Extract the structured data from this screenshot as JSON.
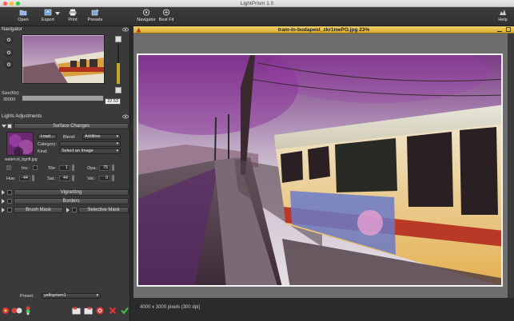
{
  "window": {
    "title": "LightPrism 1.0"
  },
  "toolbar": {
    "open": "Open",
    "export": "Export",
    "print": "Print",
    "presets": "Presets",
    "navigator": "Navigator",
    "best_fit": "Best Fit",
    "help": "Help"
  },
  "navigator": {
    "heading": "Navigator",
    "size_label": "Size(Kb):",
    "size_value": "35000",
    "zoom_value": "22.53"
  },
  "adjustments": {
    "heading": "Lights Adjustments",
    "surface_changes": {
      "title": "Surface Changes",
      "load_button": "Load...",
      "blend_label": "Blend:",
      "blend_value": "Additive",
      "category_label": "Category:",
      "category_value": "",
      "kind_label": "Kind:",
      "kind_value": "Select an Image",
      "texture_name": "watercol_bgnft.jpg",
      "inv_label": "Inv.:",
      "tile_label": "Tile:",
      "tile_value": "1",
      "opa_label": "Opa.:",
      "opa_value": "75",
      "hue_label": "Hue:",
      "hue_value": "-44",
      "sat_label": "Sat.:",
      "sat_value": "44",
      "val_label": "Val.:",
      "val_value": "0"
    },
    "vignetting": "Vignetting",
    "borders": "Borders",
    "brush_mask": "Brush Mask",
    "selective_mask": "Selective Mask",
    "preset_label": "Preset:",
    "preset_value": "yelloprism1"
  },
  "image_window": {
    "title": "tram-in-budapest_zkr1nwPO.jpg 23%",
    "status": "4000 x 3000 pixels (300 dpi)"
  },
  "colors": {
    "accent_title": "#e8c050",
    "panel_bg": "#3a3a3a",
    "canvas_bg": "#6e6e6e"
  }
}
